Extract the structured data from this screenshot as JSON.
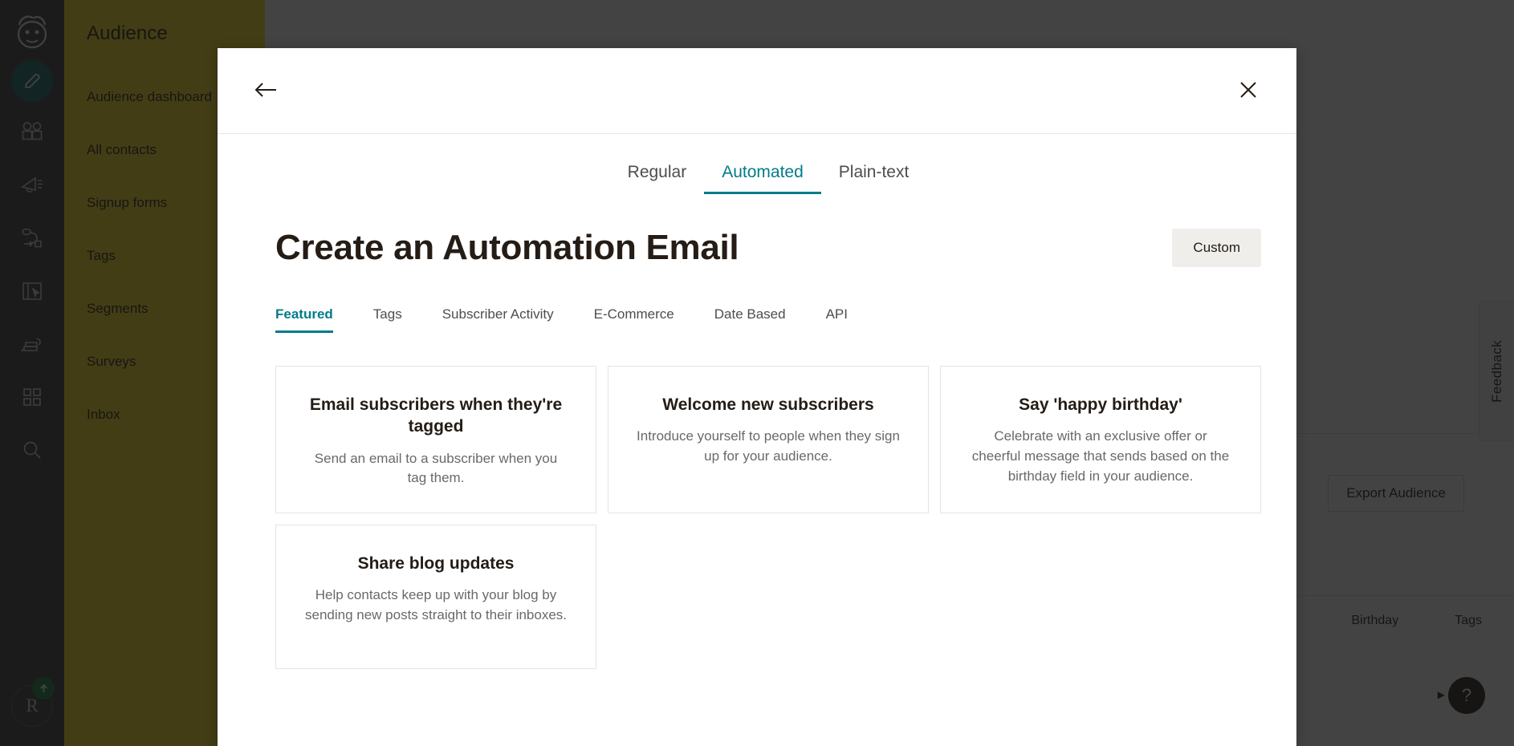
{
  "background": {
    "nav": {
      "title": "Audience",
      "items": [
        {
          "label": "Audience dashboard"
        },
        {
          "label": "All contacts"
        },
        {
          "label": "Signup forms"
        },
        {
          "label": "Tags"
        },
        {
          "label": "Segments"
        },
        {
          "label": "Surveys"
        },
        {
          "label": "Inbox"
        }
      ]
    },
    "rail": {
      "logo_icon": "mailchimp-freddie-logo",
      "items": [
        {
          "icon": "pencil-icon",
          "active": true
        },
        {
          "icon": "audience-people-icon",
          "active": false
        },
        {
          "icon": "campaigns-megaphone-icon",
          "active": false
        },
        {
          "icon": "automations-journey-icon",
          "active": false
        },
        {
          "icon": "website-page-icon",
          "active": false
        },
        {
          "icon": "content-studio-icon",
          "active": false
        },
        {
          "icon": "apps-grid-icon",
          "active": false
        },
        {
          "icon": "search-icon",
          "active": false
        }
      ],
      "avatar_initial": "R",
      "upgrade_icon": "arrow-up-icon"
    },
    "export_button": "Export Audience",
    "feedback_tab": "Feedback",
    "table_headers": [
      "Birthday",
      "Tags"
    ],
    "help_button": "?"
  },
  "modal": {
    "back_icon": "arrow-left-icon",
    "close_icon": "close-x-icon",
    "top_tabs": [
      {
        "label": "Regular",
        "active": false
      },
      {
        "label": "Automated",
        "active": true
      },
      {
        "label": "Plain-text",
        "active": false
      }
    ],
    "title": "Create an Automation Email",
    "custom_button": "Custom",
    "sub_tabs": [
      {
        "label": "Featured",
        "active": true
      },
      {
        "label": "Tags",
        "active": false
      },
      {
        "label": "Subscriber Activity",
        "active": false
      },
      {
        "label": "E-Commerce",
        "active": false
      },
      {
        "label": "Date Based",
        "active": false
      },
      {
        "label": "API",
        "active": false
      }
    ],
    "cards": [
      {
        "title": "Email subscribers when they're tagged",
        "description": "Send an email to a subscriber when you tag them."
      },
      {
        "title": "Welcome new subscribers",
        "description": "Introduce yourself to people when they sign up for your audience."
      },
      {
        "title": "Say 'happy birthday'",
        "description": "Celebrate with an exclusive offer or cheerful message that sends based on the birthday field in your audience."
      },
      {
        "title": "Share blog updates",
        "description": "Help contacts keep up with your blog by sending new posts straight to their inboxes."
      }
    ]
  },
  "colors": {
    "accent_teal": "#007c89",
    "brand_yellow": "#ffe01b",
    "rail_dark": "#3a3a3a",
    "text_dark": "#241c15",
    "text_muted": "#696969"
  }
}
